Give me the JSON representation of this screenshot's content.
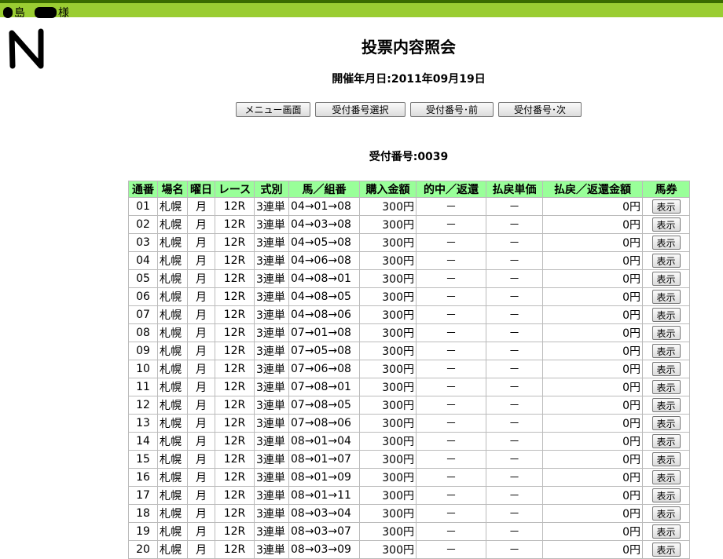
{
  "header": {
    "user_suffix_1": "島",
    "user_suffix_2": "様"
  },
  "page": {
    "title": "投票内容照会",
    "date_label": "開催年月日:",
    "date": "2011年09月19日",
    "receipt_label": "受付番号:",
    "receipt_no": "0039"
  },
  "buttons": {
    "menu": "メニュー画面",
    "select": "受付番号選択",
    "prev": "受付番号･前",
    "next": "受付番号･次"
  },
  "table": {
    "headers": [
      "通番",
      "場名",
      "曜日",
      "レース",
      "式別",
      "馬／組番",
      "購入金額",
      "的中／返還",
      "払戻単価",
      "払戻／返還金額",
      "馬券"
    ],
    "rows": [
      [
        "01",
        "札幌",
        "月",
        "12R",
        "3連単",
        "04→01→08",
        "300円",
        "－",
        "－",
        "0円",
        "表示"
      ],
      [
        "02",
        "札幌",
        "月",
        "12R",
        "3連単",
        "04→03→08",
        "300円",
        "－",
        "－",
        "0円",
        "表示"
      ],
      [
        "03",
        "札幌",
        "月",
        "12R",
        "3連単",
        "04→05→08",
        "300円",
        "－",
        "－",
        "0円",
        "表示"
      ],
      [
        "04",
        "札幌",
        "月",
        "12R",
        "3連単",
        "04→06→08",
        "300円",
        "－",
        "－",
        "0円",
        "表示"
      ],
      [
        "05",
        "札幌",
        "月",
        "12R",
        "3連単",
        "04→08→01",
        "300円",
        "－",
        "－",
        "0円",
        "表示"
      ],
      [
        "06",
        "札幌",
        "月",
        "12R",
        "3連単",
        "04→08→05",
        "300円",
        "－",
        "－",
        "0円",
        "表示"
      ],
      [
        "07",
        "札幌",
        "月",
        "12R",
        "3連単",
        "04→08→06",
        "300円",
        "－",
        "－",
        "0円",
        "表示"
      ],
      [
        "08",
        "札幌",
        "月",
        "12R",
        "3連単",
        "07→01→08",
        "300円",
        "－",
        "－",
        "0円",
        "表示"
      ],
      [
        "09",
        "札幌",
        "月",
        "12R",
        "3連単",
        "07→05→08",
        "300円",
        "－",
        "－",
        "0円",
        "表示"
      ],
      [
        "10",
        "札幌",
        "月",
        "12R",
        "3連単",
        "07→06→08",
        "300円",
        "－",
        "－",
        "0円",
        "表示"
      ],
      [
        "11",
        "札幌",
        "月",
        "12R",
        "3連単",
        "07→08→01",
        "300円",
        "－",
        "－",
        "0円",
        "表示"
      ],
      [
        "12",
        "札幌",
        "月",
        "12R",
        "3連単",
        "07→08→05",
        "300円",
        "－",
        "－",
        "0円",
        "表示"
      ],
      [
        "13",
        "札幌",
        "月",
        "12R",
        "3連単",
        "07→08→06",
        "300円",
        "－",
        "－",
        "0円",
        "表示"
      ],
      [
        "14",
        "札幌",
        "月",
        "12R",
        "3連単",
        "08→01→04",
        "300円",
        "－",
        "－",
        "0円",
        "表示"
      ],
      [
        "15",
        "札幌",
        "月",
        "12R",
        "3連単",
        "08→01→07",
        "300円",
        "－",
        "－",
        "0円",
        "表示"
      ],
      [
        "16",
        "札幌",
        "月",
        "12R",
        "3連単",
        "08→01→09",
        "300円",
        "－",
        "－",
        "0円",
        "表示"
      ],
      [
        "17",
        "札幌",
        "月",
        "12R",
        "3連単",
        "08→01→11",
        "300円",
        "－",
        "－",
        "0円",
        "表示"
      ],
      [
        "18",
        "札幌",
        "月",
        "12R",
        "3連単",
        "08→03→04",
        "300円",
        "－",
        "－",
        "0円",
        "表示"
      ],
      [
        "19",
        "札幌",
        "月",
        "12R",
        "3連単",
        "08→03→07",
        "300円",
        "－",
        "－",
        "0円",
        "表示"
      ],
      [
        "20",
        "札幌",
        "月",
        "12R",
        "3連単",
        "08→03→09",
        "300円",
        "－",
        "－",
        "0円",
        "表示"
      ]
    ]
  }
}
